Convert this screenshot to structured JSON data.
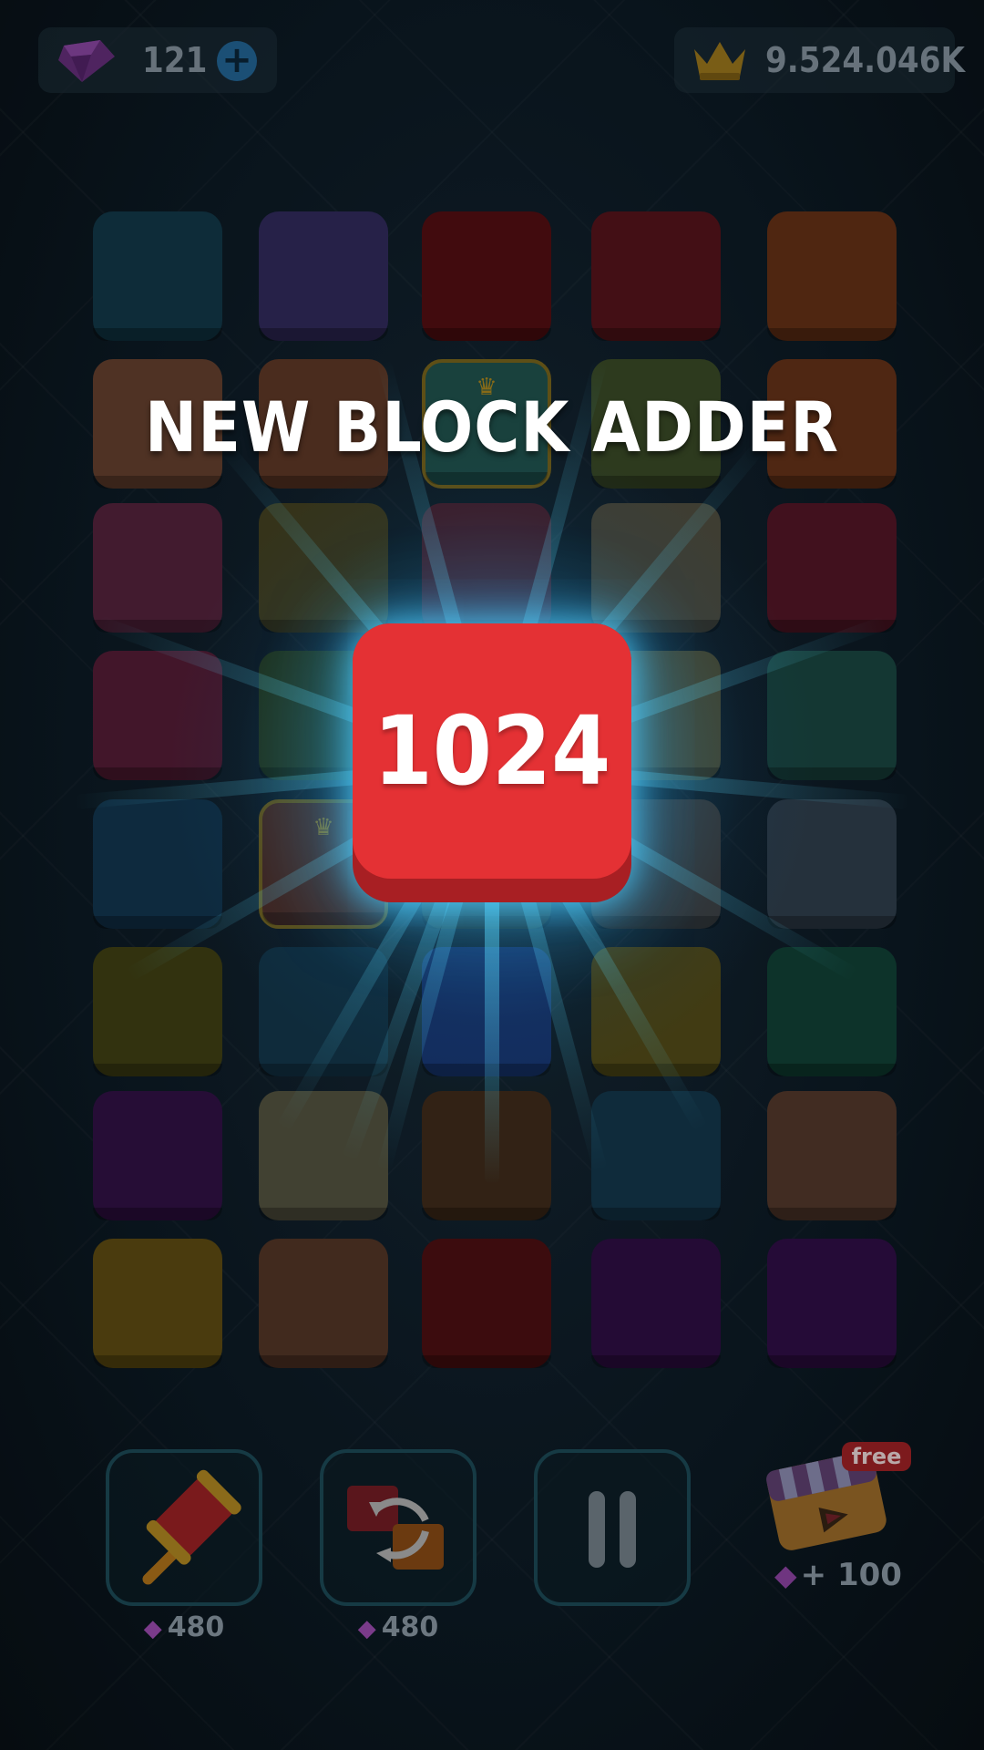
{
  "header": {
    "gems_count": "121",
    "plus_label": "+",
    "crowns_count": "9.524.046K"
  },
  "board": {
    "tiles": [
      [
        "#103341",
        "#2c2653",
        "#4b0d10",
        "#4d1218",
        "#5b2c14"
      ],
      [
        "#5a3a2a",
        "#553323",
        "#1d4a46",
        "#344223",
        "#5b2d16"
      ],
      [
        "#4c1f36",
        "#3d3b1e",
        "#46202e",
        "#47463a",
        "#4a1423"
      ],
      [
        "#4c1a30",
        "#25391f",
        "#3a4a2c",
        "#4b4a33",
        "#173f3b"
      ],
      [
        "#113047",
        "#4b2a22",
        "#2a3a35",
        "#3a3a3a",
        "#2b3845"
      ],
      [
        "#3a3a12",
        "#123244",
        "#16336a",
        "#4a4416",
        "#0f3b30"
      ],
      [
        "#2c0f3e",
        "#4b4a3a",
        "#3a2718",
        "#123244",
        "#4a3327"
      ],
      [
        "#554410",
        "#4b3023",
        "#450e10",
        "#2a0d3d",
        "#2b0d3f"
      ]
    ]
  },
  "popup": {
    "title": "NEW BLOCK ADDER",
    "block_value": "1024",
    "block_color": "#e43134"
  },
  "tools": {
    "hammer_cost": "480",
    "swap_cost": "480",
    "free_label": "free",
    "reward_label": "+ 100"
  }
}
